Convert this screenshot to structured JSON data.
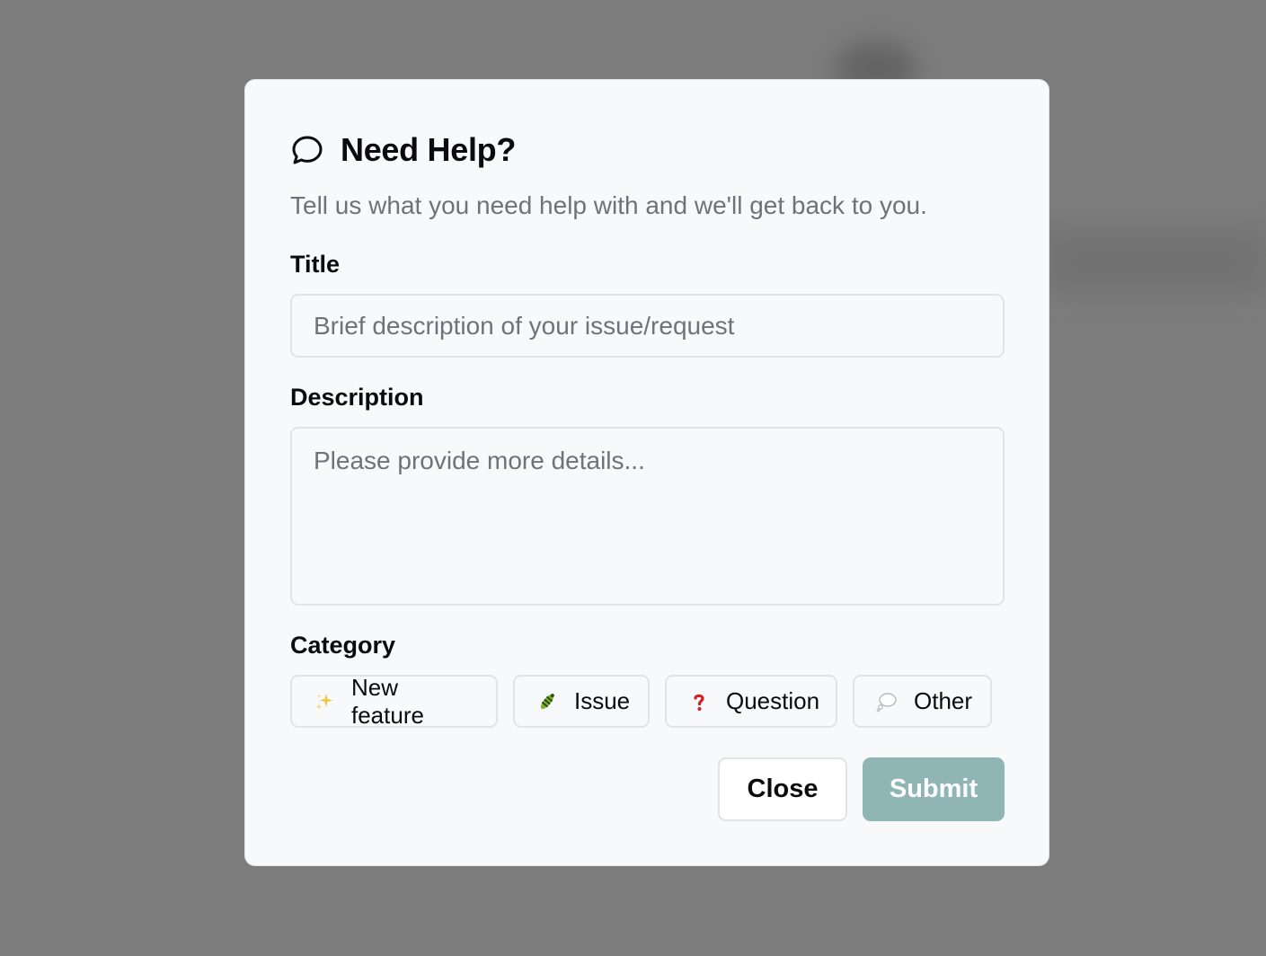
{
  "dialog": {
    "title": "Need Help?",
    "subtitle": "Tell us what you need help with and we'll get back to you.",
    "title_field": {
      "label": "Title",
      "value": "",
      "placeholder": "Brief description of your issue/request"
    },
    "description_field": {
      "label": "Description",
      "value": "",
      "placeholder": "Please provide more details..."
    },
    "category": {
      "label": "Category",
      "options": [
        {
          "label": "New feature",
          "icon": "sparkles-icon"
        },
        {
          "label": "Issue",
          "icon": "bug-icon"
        },
        {
          "label": "Question",
          "icon": "question-mark-icon"
        },
        {
          "label": "Other",
          "icon": "thought-bubble-icon"
        }
      ]
    },
    "close_label": "Close",
    "submit_label": "Submit"
  },
  "colors": {
    "overlay": "#7b7c7b",
    "modal_bg": "#f8f9fb",
    "submit_bg": "#8fb6b4",
    "muted_text": "#6f727a"
  }
}
